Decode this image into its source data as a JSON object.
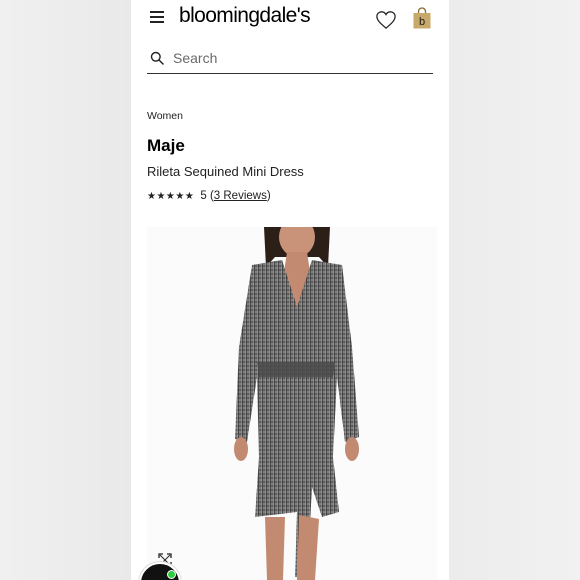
{
  "header": {
    "logo": "bloomingdale's",
    "menu_icon": "hamburger-menu-icon",
    "wishlist_icon": "heart-icon",
    "bag_icon": "shopping-bag-icon",
    "bag_letter": "b"
  },
  "search": {
    "placeholder": "Search"
  },
  "breadcrumb": "Women",
  "product": {
    "brand": "Maje",
    "name": "Rileta Sequined Mini Dress",
    "stars": "★★★★★",
    "rating": "5",
    "reviews_open": "(",
    "reviews_link": "3 Reviews",
    "reviews_close": ")"
  },
  "colors": {
    "accent": "#c8a96a",
    "text": "#111111",
    "chat_dot": "#2ecc40"
  }
}
